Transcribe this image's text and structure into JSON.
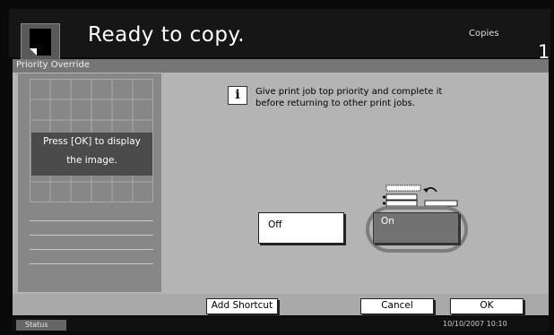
{
  "header": {
    "title": "Ready to copy.",
    "copies_label": "Copies",
    "copies_value": "1",
    "document_icon": "document-icon"
  },
  "panel": {
    "tab_label": "Priority Override",
    "preview_message": [
      "Press [OK] to display",
      "the image."
    ],
    "info_icon": "info-icon",
    "info_text": [
      "Give print job top priority and complete it",
      "before returning to other print jobs."
    ],
    "options": [
      {
        "label": "Off",
        "selected": false
      },
      {
        "label": "On",
        "selected": true
      }
    ]
  },
  "bottom": {
    "add_shortcut_label": "Add Shortcut",
    "cancel_label": "Cancel",
    "ok_label": "OK"
  },
  "status_bar": {
    "status_label": "Status",
    "datetime": "10/10/2007   10:10"
  },
  "colors": {
    "screen_bg": "#0a0a0a",
    "panel_bg": "#b4b4b4",
    "selected_button": "#727272"
  }
}
